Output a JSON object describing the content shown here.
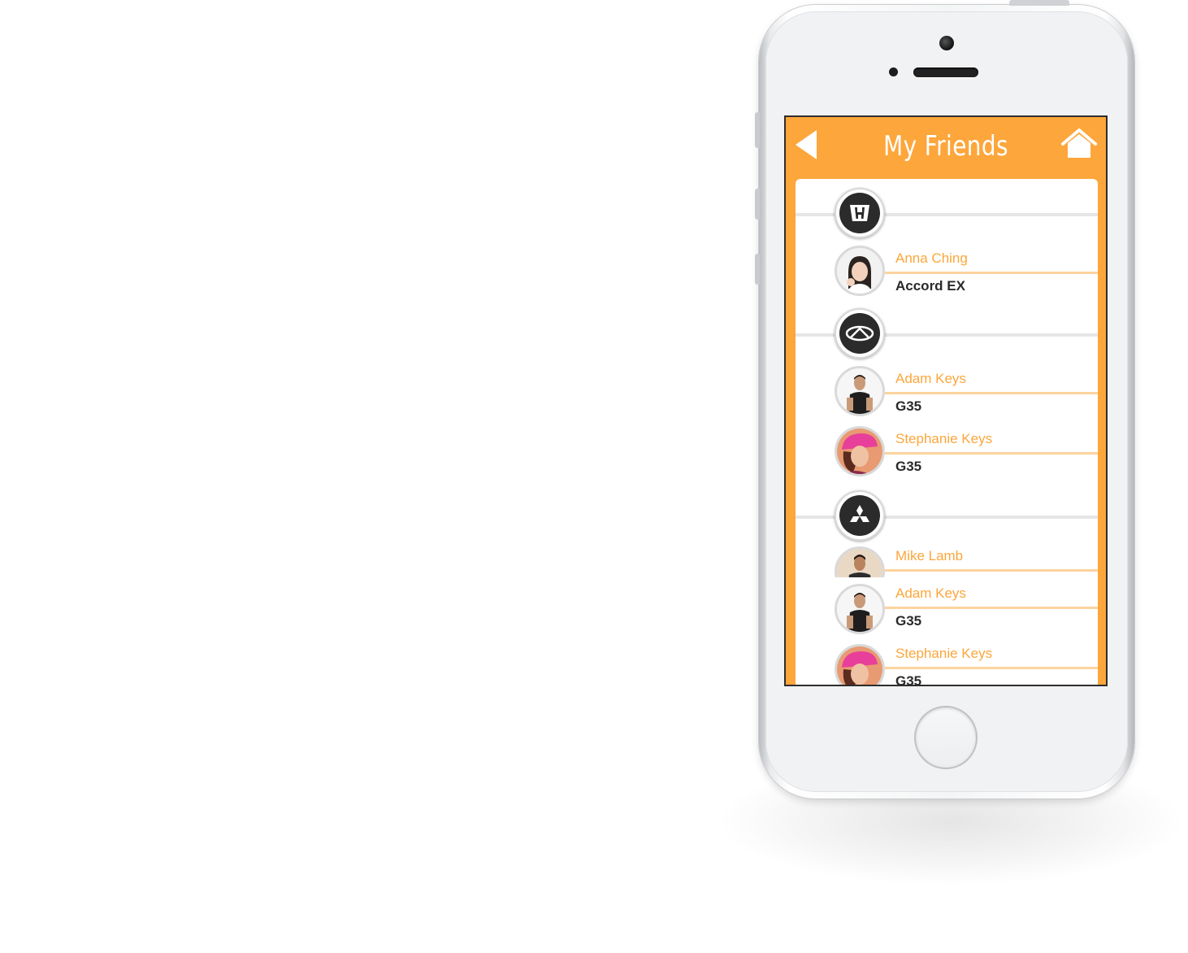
{
  "header": {
    "title": "My Friends",
    "back_icon": "back-arrow-icon",
    "home_icon": "home-icon"
  },
  "colors": {
    "accent": "#fda63b",
    "name_text": "#fda63b",
    "car_text": "#2a2a2a",
    "list_bg": "#ffffff"
  },
  "groups": [
    {
      "brand_icon": "honda-logo-icon",
      "friends": [
        {
          "name": "Anna Ching",
          "car": "Accord EX",
          "avatar": "woman-avatar"
        }
      ]
    },
    {
      "brand_icon": "infiniti-logo-icon",
      "friends": [
        {
          "name": "Adam Keys",
          "car": "G35",
          "avatar": "man-avatar"
        },
        {
          "name": "Stephanie Keys",
          "car": "G35",
          "avatar": "woman-pink-hat-avatar"
        }
      ]
    },
    {
      "brand_icon": "mitsubishi-logo-icon",
      "friends": [
        {
          "name": "Mike Lamb",
          "car": "",
          "avatar": "man-avatar"
        },
        {
          "name": "Adam Keys",
          "car": "G35",
          "avatar": "man-avatar"
        },
        {
          "name": "Stephanie Keys",
          "car": "G35",
          "avatar": "woman-pink-hat-avatar"
        }
      ]
    }
  ]
}
